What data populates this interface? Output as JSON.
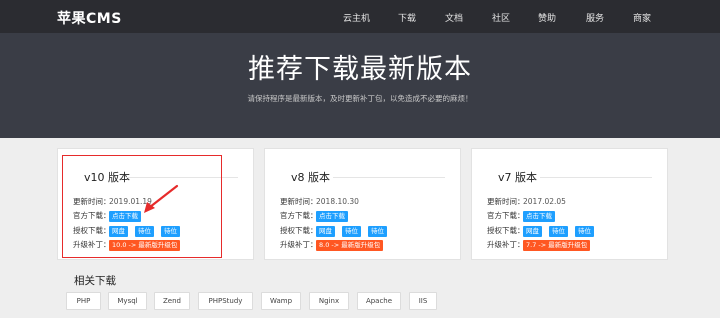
{
  "nav": {
    "logo": "苹果CMS",
    "items": [
      "云主机",
      "下载",
      "文档",
      "社区",
      "赞助",
      "服务",
      "商家"
    ]
  },
  "hero": {
    "title": "推荐下载最新版本",
    "subtitle": "请保持程序是最新版本，及时更新补丁包，以免造成不必要的麻烦！"
  },
  "labels": {
    "update_time": "更新时间：",
    "official_download": "官方下载：",
    "authorized_download": "授权下载：",
    "upgrade_patch": "升级补丁："
  },
  "cards": [
    {
      "title": "v10 版本",
      "date": "2019.01.19",
      "official_button": "点击下载",
      "mirrors": [
        "网盘",
        "待位",
        "待位"
      ],
      "patch": "10.0 -> 最新版升级包"
    },
    {
      "title": "v8 版本",
      "date": "2018.10.30",
      "official_button": "点击下载",
      "mirrors": [
        "网盘",
        "待位",
        "待位"
      ],
      "patch": "8.0 -> 最新版升级包"
    },
    {
      "title": "v7 版本",
      "date": "2017.02.05",
      "official_button": "点击下载",
      "mirrors": [
        "网盘",
        "待位",
        "待位"
      ],
      "patch": "7.7 -> 最新版升级包"
    }
  ],
  "related": {
    "title": "相关下载",
    "tags": [
      "PHP",
      "Mysql",
      "Zend",
      "PHPStudy",
      "Wamp",
      "Nginx",
      "Apache",
      "IIS"
    ]
  },
  "colors": {
    "nav_bg": "#2b2c31",
    "hero_bg": "#3a3d46",
    "button_blue": "#1e9fff",
    "button_orange": "#ff5722",
    "annotation_red": "#e62b2b"
  }
}
